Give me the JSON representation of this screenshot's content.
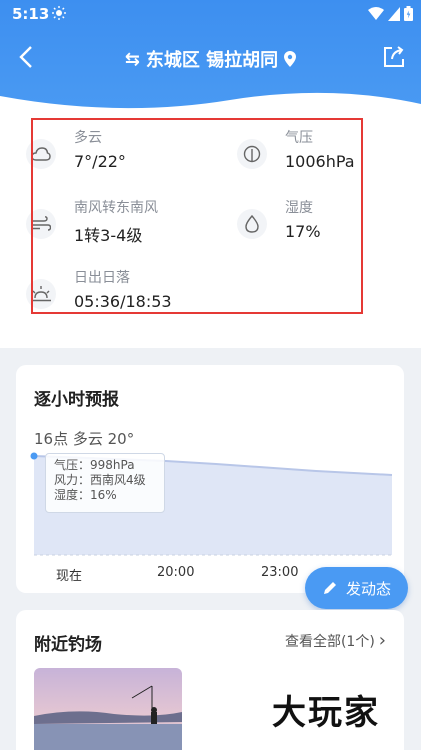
{
  "status_bar": {
    "time": "5:13"
  },
  "nav": {
    "title": "东城区 锡拉胡同",
    "swap_icon": "⇆"
  },
  "weather_info": {
    "condition": {
      "label": "多云",
      "value": "7°/22°"
    },
    "pressure": {
      "label": "气压",
      "value": "1006hPa"
    },
    "wind": {
      "label": "南风转东南风",
      "value": "1转3-4级"
    },
    "humidity": {
      "label": "湿度",
      "value": "17%"
    },
    "sun": {
      "label": "日出日落",
      "value": "05:36/18:53"
    }
  },
  "hourly": {
    "title": "逐小时预报",
    "summary": "16点 多云 20°",
    "tooltip": {
      "pressure": "气压：998hPa",
      "wind": "风力：西南风4级",
      "humidity": "湿度：16%"
    },
    "x_labels": [
      "现在",
      "20:00",
      "23:00"
    ]
  },
  "fab": {
    "label": "发动态"
  },
  "nearby": {
    "title": "附近钓场",
    "more": "查看全部(1个)",
    "chevron": "›"
  },
  "watermark": {
    "text": "大玩家"
  },
  "colors": {
    "primary": "#4a9af3",
    "highlight": "#e53935"
  }
}
